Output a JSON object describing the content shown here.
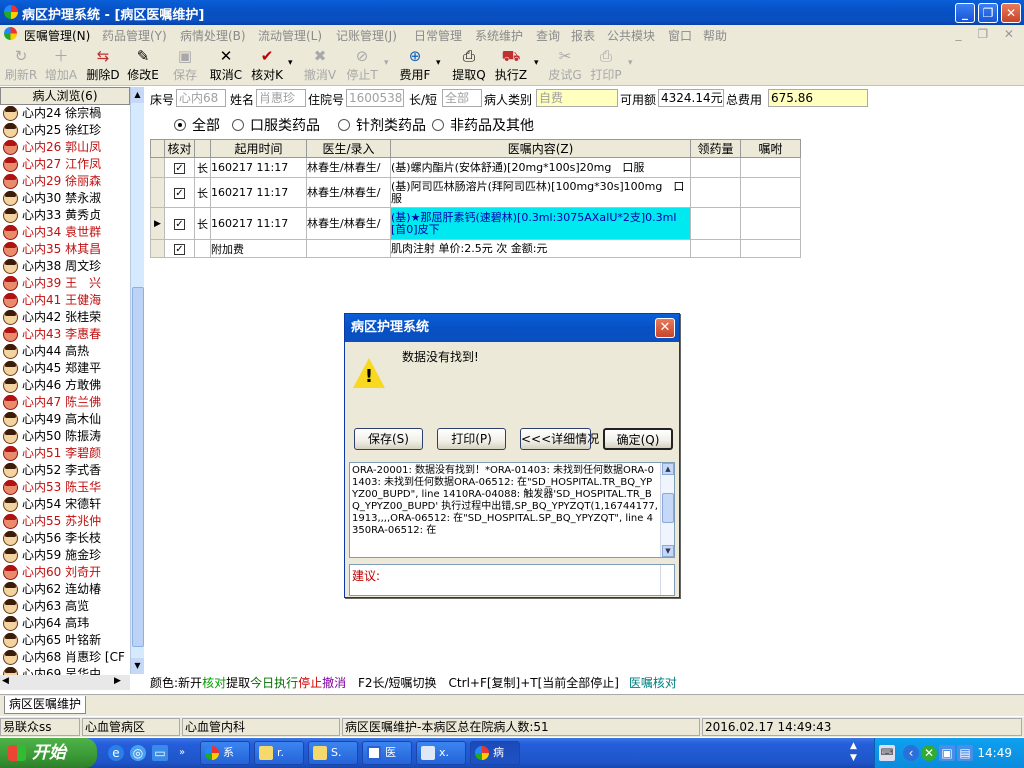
{
  "window": {
    "title": "病区护理系统 - [病区医嘱维护]",
    "controls": [
      "_",
      "❐",
      "✕"
    ]
  },
  "menu": [
    {
      "label": "医嘱管理(N)",
      "enabled": true
    },
    {
      "label": "药品管理(Y)",
      "enabled": false
    },
    {
      "label": "病情处理(B)",
      "enabled": false
    },
    {
      "label": "流动管理(L)",
      "enabled": false
    },
    {
      "label": "记账管理(J)",
      "enabled": false
    },
    {
      "label": "日常管理",
      "enabled": false
    },
    {
      "label": "系统维护",
      "enabled": false
    },
    {
      "label": "查询",
      "enabled": false
    },
    {
      "label": "报表",
      "enabled": false
    },
    {
      "label": "公共模块",
      "enabled": false
    },
    {
      "label": "窗口",
      "enabled": false
    },
    {
      "label": "帮助",
      "enabled": false
    }
  ],
  "toolbar": [
    {
      "label": "刷新R",
      "icon": "refresh-icon",
      "glyph": "↻",
      "enabled": false
    },
    {
      "label": "增加A",
      "icon": "add-icon",
      "glyph": "＋",
      "enabled": false
    },
    {
      "label": "删除D",
      "icon": "delete-icon",
      "glyph": "⇆",
      "enabled": true
    },
    {
      "label": "修改E",
      "icon": "edit-icon",
      "glyph": "✎",
      "enabled": true
    },
    {
      "label": "保存",
      "icon": "save-icon",
      "glyph": "▣",
      "enabled": false
    },
    {
      "label": "取消C",
      "icon": "cancel-icon",
      "glyph": "✕",
      "enabled": true
    },
    {
      "label": "核对K",
      "icon": "check-icon",
      "glyph": "✔",
      "enabled": true
    },
    {
      "label": "撤消V",
      "icon": "undo-icon",
      "glyph": "✖",
      "enabled": false
    },
    {
      "label": "停止T",
      "icon": "stop-icon",
      "glyph": "⊘",
      "enabled": false
    },
    {
      "label": "费用F",
      "icon": "fee-icon",
      "glyph": "⊕",
      "enabled": true
    },
    {
      "label": "提取Q",
      "icon": "extract-icon",
      "glyph": "⎙",
      "enabled": true
    },
    {
      "label": "执行Z",
      "icon": "execute-icon",
      "glyph": "⛟",
      "enabled": true
    },
    {
      "label": "皮试G",
      "icon": "skintest-icon",
      "glyph": "✂",
      "enabled": false
    },
    {
      "label": "打印P",
      "icon": "print-icon",
      "glyph": "⎙",
      "enabled": false
    }
  ],
  "left_panel": {
    "header": "病人浏览(6)",
    "patients": [
      {
        "label": "心内24 徐宗楇",
        "red": false
      },
      {
        "label": "心内25 徐红珍",
        "red": false
      },
      {
        "label": "心内26 郭山凤",
        "red": true
      },
      {
        "label": "心内27 江作凤",
        "red": true
      },
      {
        "label": "心内29 徐丽森",
        "red": true
      },
      {
        "label": "心内30 禁永淑",
        "red": false
      },
      {
        "label": "心内33 黄秀贞",
        "red": false
      },
      {
        "label": "心内34 袁世群",
        "red": true
      },
      {
        "label": "心内35 林其昌",
        "red": true
      },
      {
        "label": "心内38 周文珍",
        "red": false
      },
      {
        "label": "心内39 王　兴",
        "red": true
      },
      {
        "label": "心内41 王健海",
        "red": true
      },
      {
        "label": "心内42 张桂荣",
        "red": false
      },
      {
        "label": "心内43 李惠春",
        "red": true
      },
      {
        "label": "心内44 高热",
        "red": false
      },
      {
        "label": "心内45 郑建平",
        "red": false
      },
      {
        "label": "心内46 方敢佛",
        "red": false
      },
      {
        "label": "心内47 陈兰佛",
        "red": true
      },
      {
        "label": "心内49 高木仙",
        "red": false
      },
      {
        "label": "心内50 陈振涛",
        "red": false
      },
      {
        "label": "心内51 李碧颜",
        "red": true
      },
      {
        "label": "心内52 李式香",
        "red": false
      },
      {
        "label": "心内53 陈玉华",
        "red": true
      },
      {
        "label": "心内54 宋德轩",
        "red": false
      },
      {
        "label": "心内55 苏兆仲",
        "red": true
      },
      {
        "label": "心内56 李长枝",
        "red": false
      },
      {
        "label": "心内59 施金珍",
        "red": false
      },
      {
        "label": "心内60 刘奇开",
        "red": true
      },
      {
        "label": "心内62 连幼椿",
        "red": false
      },
      {
        "label": "心内63 高览",
        "red": false
      },
      {
        "label": "心内64 高玮",
        "red": false
      },
      {
        "label": "心内65 叶铭新",
        "red": false
      },
      {
        "label": "心内68 肖惠珍 [CF",
        "red": false
      },
      {
        "label": "心内69 吴华由",
        "red": false
      }
    ]
  },
  "info": {
    "bed_label": "床号",
    "bed_value": "心内68",
    "name_label": "姓名",
    "name_value": "肖惠珍",
    "inpatient_label": "住院号",
    "inpatient_value": "1600538",
    "type_label": "长/短",
    "type_value": "全部",
    "category_label": "病人类别",
    "category_value": "自费",
    "available_label": "可用额",
    "available_value": "4324.14元",
    "total_label": "总费用",
    "total_value": "675.86"
  },
  "filters": [
    {
      "label": "全部",
      "selected": true
    },
    {
      "label": "口服类药品",
      "selected": false
    },
    {
      "label": "针剂类药品",
      "selected": false
    },
    {
      "label": "非药品及其他",
      "selected": false
    }
  ],
  "table": {
    "headers": [
      "核对",
      "起用时间",
      "医生/录入",
      "医嘱内容(Z)",
      "领药量",
      "嘱咐"
    ],
    "rows": [
      {
        "pointer": "",
        "check": "✓",
        "kind": "长",
        "time": "160217 11:17",
        "doctor": "林春生/林春生/",
        "content": "(基)螺内酯片(安体舒通)[20mg*100s]20mg　口服",
        "qty": "",
        "note": "",
        "hl": false
      },
      {
        "pointer": "",
        "check": "✓",
        "kind": "长",
        "time": "160217 11:17",
        "doctor": "林春生/林春生/",
        "content": "(基)阿司匹林肠溶片(拜阿司匹林)[100mg*30s]100mg　口服",
        "qty": "",
        "note": "",
        "hl": false
      },
      {
        "pointer": "▶",
        "check": "✓",
        "kind": "长",
        "time": "160217 11:17",
        "doctor": "林春生/林春生/",
        "content": "(基)★那屈肝素钙(速碧林)[0.3ml:3075AXaIU*2支]0.3ml　[首0]皮下",
        "qty": "",
        "note": "",
        "hl": true
      },
      {
        "pointer": "",
        "check": "✓",
        "kind": "",
        "time": "附加费",
        "doctor": "",
        "content": "肌肉注射 单价:2.5元 次 金额:元",
        "qty": "",
        "note": "",
        "hl": false
      }
    ]
  },
  "legend": {
    "prefix": "颜色:",
    "items": [
      {
        "text": "新开",
        "color": "#000000"
      },
      {
        "text": "核对",
        "color": "#00a000"
      },
      {
        "text": "提取",
        "color": "#000000"
      },
      {
        "text": "今日执行",
        "color": "#007000"
      },
      {
        "text": "停止",
        "color": "#d00000"
      },
      {
        "text": "撤消",
        "color": "#8000a0"
      }
    ],
    "suffix1": "F2长/短嘱切换　Ctrl+F[复制]+T[当前全部停止]",
    "suffix2": "医嘱核对",
    "suffix2_color": "#008080"
  },
  "tab_label": "病区医嘱维护",
  "status": {
    "user": "易联众ss",
    "ward": "心血管病区",
    "dept": "心血管内科",
    "message": "病区医嘱维护-本病区总在院病人数:51",
    "datetime": "2016.02.17 14:49:43"
  },
  "dialog": {
    "title": "病区护理系统",
    "message": "数据没有找到!",
    "buttons": {
      "save": "保存(S)",
      "print": "打印(P)",
      "detail": "<<<详细情况",
      "ok": "确定(Q)"
    },
    "detail_text": "ORA-20001: 数据没有找到！*ORA-01403: 未找到任何数据ORA-01403: 未找到任何数据ORA-06512: 在\"SD_HOSPITAL.TR_BQ_YPYZ00_BUPD\", line 1410RA-04088: 触发器'SD_HOSPITAL.TR_BQ_YPYZ00_BUPD' 执行过程中出错,SP_BQ_YPYZQT(1,16744177,1913,,,,ORA-06512: 在\"SD_HOSPITAL.SP_BQ_YPYZQT\", line 4350RA-06512: 在",
    "suggest_label": "建议:"
  },
  "taskbar": {
    "start": "开始",
    "tasks": [
      "系",
      "r.",
      "S.",
      "医",
      "x.",
      "病"
    ],
    "clock": "14:49"
  },
  "colors": {
    "accent": "#0a4fbf",
    "highlight": "#00e8f0",
    "alert_red": "#c01010"
  }
}
